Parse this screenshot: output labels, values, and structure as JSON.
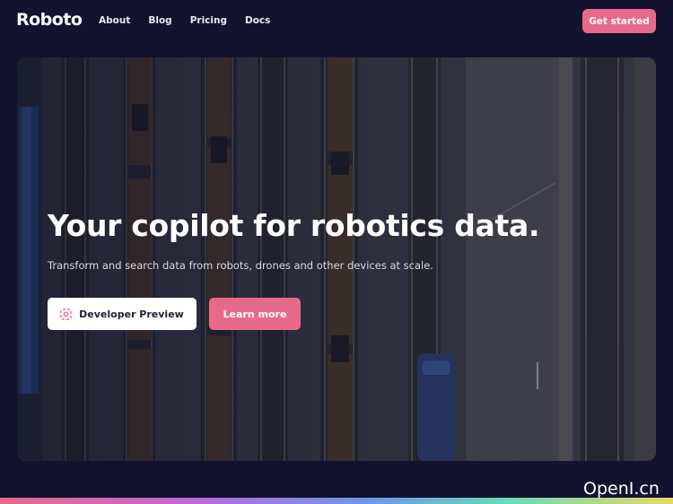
{
  "nav": {
    "logo": "Roboto",
    "links": [
      "About",
      "Blog",
      "Pricing",
      "Docs"
    ],
    "cta": "Get started"
  },
  "hero": {
    "title": "Your copilot for robotics data.",
    "subtitle": "Transform and search data from robots, drones and other devices at scale.",
    "primary_button": "Developer Preview",
    "secondary_button": "Learn more"
  },
  "watermark": "OpenI.cn",
  "colors": {
    "background": "#13132f",
    "accent": "#e86a8a"
  }
}
